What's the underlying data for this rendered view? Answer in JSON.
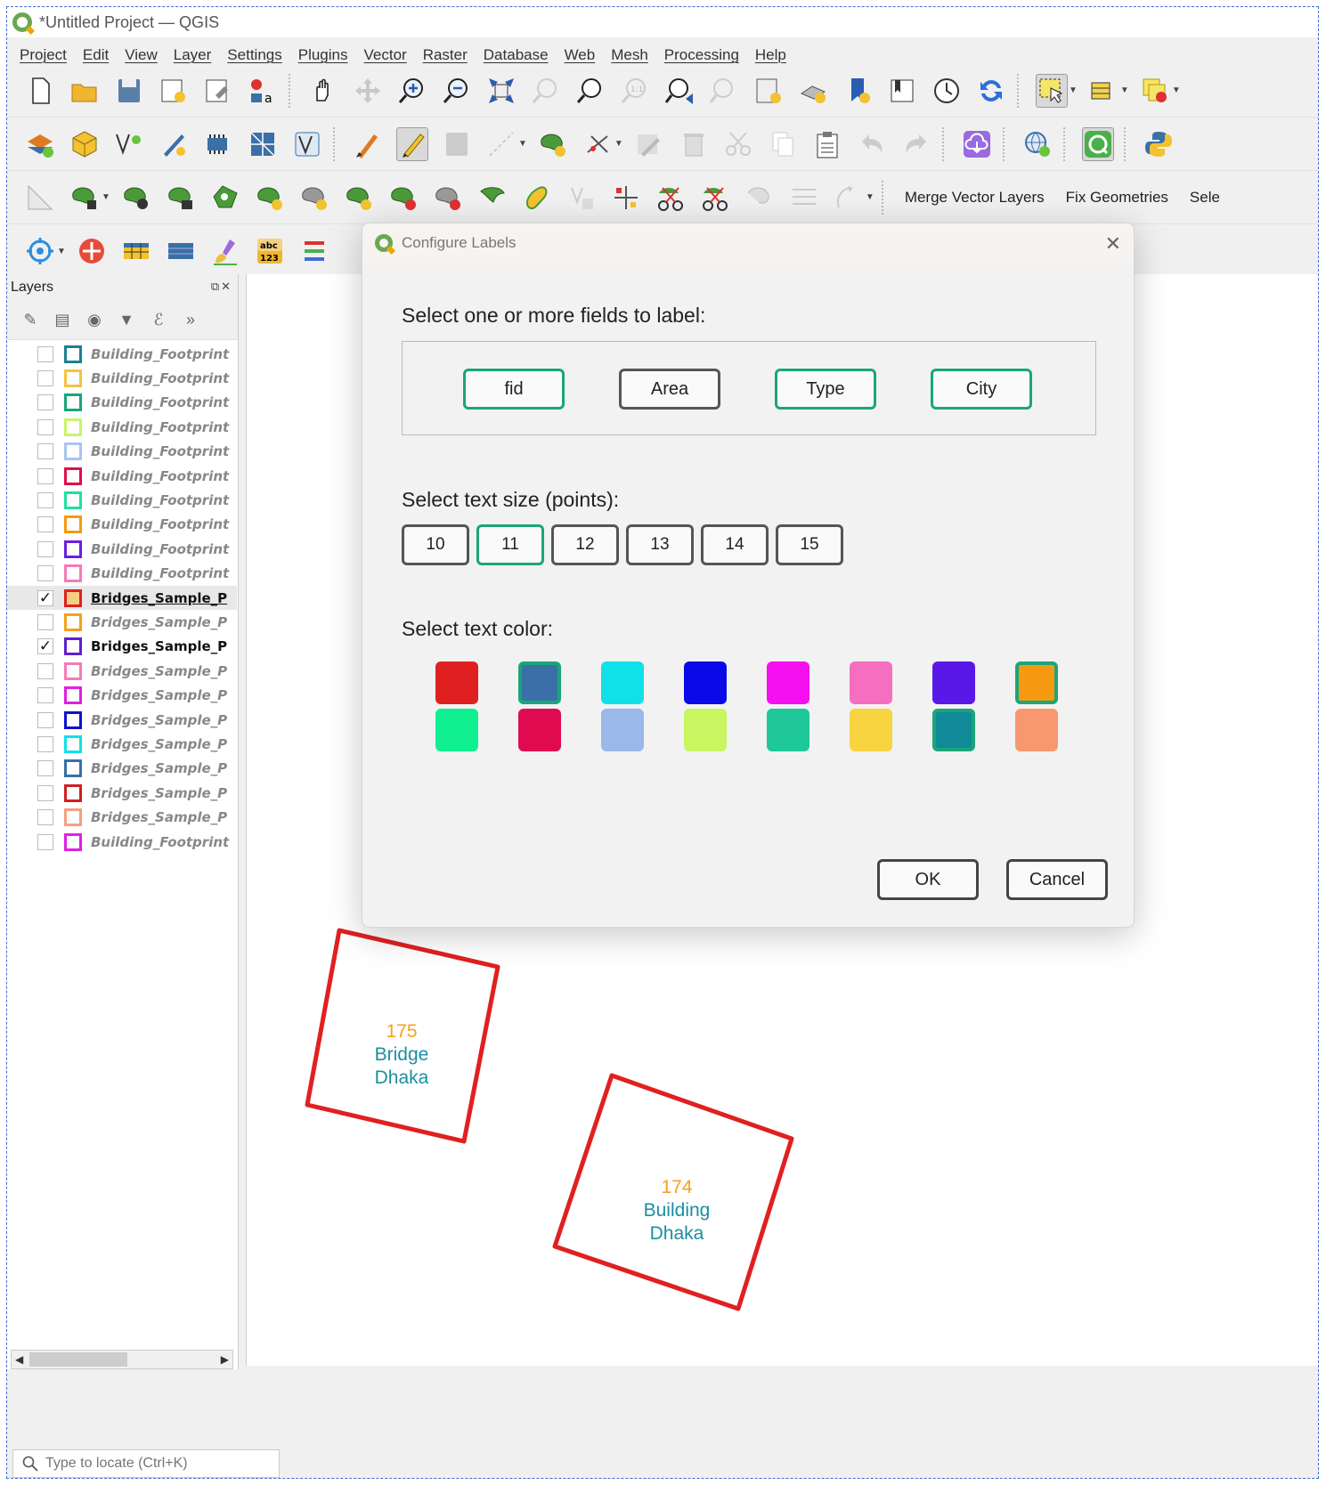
{
  "window": {
    "title": "*Untitled Project — QGIS"
  },
  "menu": [
    "Project",
    "Edit",
    "View",
    "Layer",
    "Settings",
    "Plugins",
    "Vector",
    "Raster",
    "Database",
    "Web",
    "Mesh",
    "Processing",
    "Help"
  ],
  "toolbar3": {
    "merge_label": "Merge Vector Layers",
    "fix_label": "Fix Geometries",
    "select_label": "Sele"
  },
  "layers": {
    "title": "Layers",
    "items": [
      {
        "name": "Building_Footprint",
        "checked": "",
        "color": "#1f7f8f"
      },
      {
        "name": "Building_Footprint",
        "checked": "",
        "color": "#f5c242"
      },
      {
        "name": "Building_Footprint",
        "checked": "",
        "color": "#1aa57a"
      },
      {
        "name": "Building_Footprint",
        "checked": "",
        "color": "#c7f56a"
      },
      {
        "name": "Building_Footprint",
        "checked": "",
        "color": "#a8c4f0"
      },
      {
        "name": "Building_Footprint",
        "checked": "",
        "color": "#e0104a"
      },
      {
        "name": "Building_Footprint",
        "checked": "",
        "color": "#1fe0a0"
      },
      {
        "name": "Building_Footprint",
        "checked": "",
        "color": "#f59a10"
      },
      {
        "name": "Building_Footprint",
        "checked": "",
        "color": "#6a20e0"
      },
      {
        "name": "Building_Footprint",
        "checked": "",
        "color": "#f57ab8"
      },
      {
        "name": "Bridges_Sample_P",
        "checked": "✓",
        "color": "#e02020"
      },
      {
        "name": "Bridges_Sample_P",
        "checked": "",
        "color": "#f5a020"
      },
      {
        "name": "Bridges_Sample_P",
        "checked": "✓",
        "color": "#6020d0"
      },
      {
        "name": "Bridges_Sample_P",
        "checked": "",
        "color": "#f57ab8"
      },
      {
        "name": "Bridges_Sample_P",
        "checked": "",
        "color": "#e020e0"
      },
      {
        "name": "Bridges_Sample_P",
        "checked": "",
        "color": "#1010d0"
      },
      {
        "name": "Bridges_Sample_P",
        "checked": "",
        "color": "#10e0e8"
      },
      {
        "name": "Bridges_Sample_P",
        "checked": "",
        "color": "#3a6fa8"
      },
      {
        "name": "Bridges_Sample_P",
        "checked": "",
        "color": "#d02020"
      },
      {
        "name": "Bridges_Sample_P",
        "checked": "",
        "color": "#f5a080"
      },
      {
        "name": "Building_Footprint",
        "checked": "",
        "color": "#e020e0"
      }
    ]
  },
  "dialog": {
    "title": "Configure Labels",
    "close": "✕",
    "fields_label": "Select one or more fields to label:",
    "fields": [
      "fid",
      "Area",
      "Type",
      "City"
    ],
    "size_label": "Select text size (points):",
    "sizes": [
      "10",
      "11",
      "12",
      "13",
      "14",
      "15"
    ],
    "selected_size": "11",
    "color_label": "Select text color:",
    "colors": [
      "#e02020",
      "#3a6fa8",
      "#10e0e8",
      "#0a0ae8",
      "#f510f0",
      "#f56ec0",
      "#5a18e8",
      "#f59a10",
      "#10f090",
      "#e00a50",
      "#9ab8e8",
      "#c8f560",
      "#1ec898",
      "#f8d440",
      "#108a98",
      "#f89870"
    ],
    "ok_label": "OK",
    "cancel_label": "Cancel"
  },
  "map": {
    "features": [
      {
        "fid": "175",
        "type": "Bridge",
        "city": "Dhaka"
      },
      {
        "fid": "174",
        "type": "Building",
        "city": "Dhaka"
      }
    ],
    "fid_color": "#f5a020",
    "label_color": "#1a8fa0",
    "outline_color": "#e02020"
  },
  "locator": {
    "placeholder": "Type to locate (Ctrl+K)"
  }
}
